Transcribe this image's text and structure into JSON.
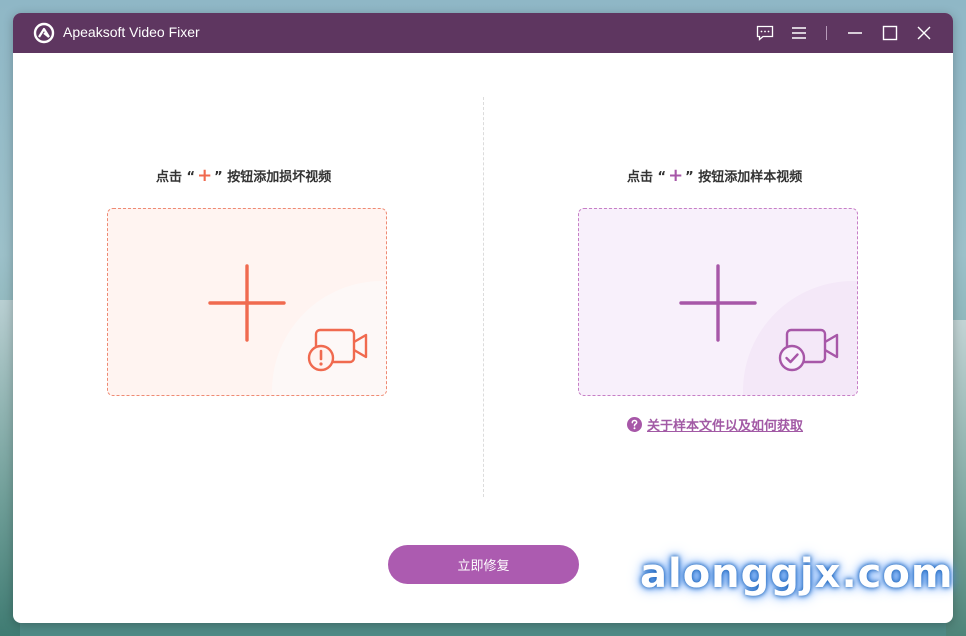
{
  "window": {
    "title": "Apeaksoft Video Fixer"
  },
  "titlebar": {
    "icons": [
      "feedback-icon",
      "menu-icon",
      "minimize-icon",
      "maximize-icon",
      "close-icon"
    ]
  },
  "left_panel": {
    "title_prefix": "点击 “",
    "title_plus": "+",
    "title_suffix": "” 按钮添加损坏视频",
    "accent": "#f06a4f"
  },
  "right_panel": {
    "title_prefix": "点击 “",
    "title_plus": "+",
    "title_suffix": "” 按钮添加样本视频",
    "accent": "#a757a8",
    "help_link": "关于样本文件以及如何获取"
  },
  "actions": {
    "repair_label": "立即修复"
  },
  "colors": {
    "titlebar": "#5e3660",
    "button": "#ac5bb0"
  },
  "watermark": {
    "text": "alonggjx.com"
  }
}
